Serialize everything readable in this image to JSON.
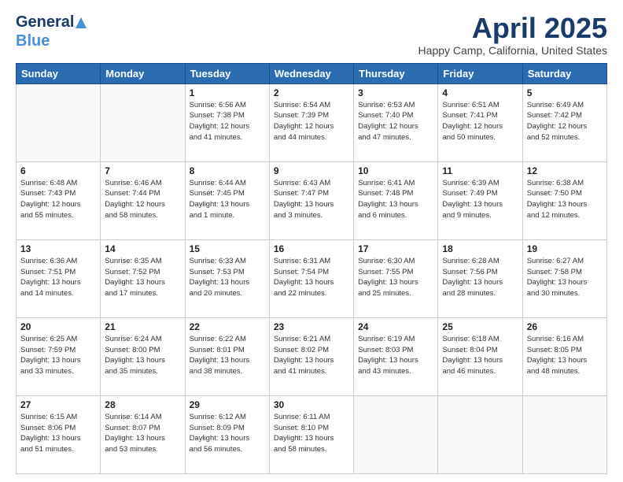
{
  "header": {
    "logo_line1": "General",
    "logo_line2": "Blue",
    "month_title": "April 2025",
    "location": "Happy Camp, California, United States"
  },
  "days_of_week": [
    "Sunday",
    "Monday",
    "Tuesday",
    "Wednesday",
    "Thursday",
    "Friday",
    "Saturday"
  ],
  "weeks": [
    [
      {
        "day": "",
        "info": ""
      },
      {
        "day": "",
        "info": ""
      },
      {
        "day": "1",
        "info": "Sunrise: 6:56 AM\nSunset: 7:38 PM\nDaylight: 12 hours\nand 41 minutes."
      },
      {
        "day": "2",
        "info": "Sunrise: 6:54 AM\nSunset: 7:39 PM\nDaylight: 12 hours\nand 44 minutes."
      },
      {
        "day": "3",
        "info": "Sunrise: 6:53 AM\nSunset: 7:40 PM\nDaylight: 12 hours\nand 47 minutes."
      },
      {
        "day": "4",
        "info": "Sunrise: 6:51 AM\nSunset: 7:41 PM\nDaylight: 12 hours\nand 50 minutes."
      },
      {
        "day": "5",
        "info": "Sunrise: 6:49 AM\nSunset: 7:42 PM\nDaylight: 12 hours\nand 52 minutes."
      }
    ],
    [
      {
        "day": "6",
        "info": "Sunrise: 6:48 AM\nSunset: 7:43 PM\nDaylight: 12 hours\nand 55 minutes."
      },
      {
        "day": "7",
        "info": "Sunrise: 6:46 AM\nSunset: 7:44 PM\nDaylight: 12 hours\nand 58 minutes."
      },
      {
        "day": "8",
        "info": "Sunrise: 6:44 AM\nSunset: 7:45 PM\nDaylight: 13 hours\nand 1 minute."
      },
      {
        "day": "9",
        "info": "Sunrise: 6:43 AM\nSunset: 7:47 PM\nDaylight: 13 hours\nand 3 minutes."
      },
      {
        "day": "10",
        "info": "Sunrise: 6:41 AM\nSunset: 7:48 PM\nDaylight: 13 hours\nand 6 minutes."
      },
      {
        "day": "11",
        "info": "Sunrise: 6:39 AM\nSunset: 7:49 PM\nDaylight: 13 hours\nand 9 minutes."
      },
      {
        "day": "12",
        "info": "Sunrise: 6:38 AM\nSunset: 7:50 PM\nDaylight: 13 hours\nand 12 minutes."
      }
    ],
    [
      {
        "day": "13",
        "info": "Sunrise: 6:36 AM\nSunset: 7:51 PM\nDaylight: 13 hours\nand 14 minutes."
      },
      {
        "day": "14",
        "info": "Sunrise: 6:35 AM\nSunset: 7:52 PM\nDaylight: 13 hours\nand 17 minutes."
      },
      {
        "day": "15",
        "info": "Sunrise: 6:33 AM\nSunset: 7:53 PM\nDaylight: 13 hours\nand 20 minutes."
      },
      {
        "day": "16",
        "info": "Sunrise: 6:31 AM\nSunset: 7:54 PM\nDaylight: 13 hours\nand 22 minutes."
      },
      {
        "day": "17",
        "info": "Sunrise: 6:30 AM\nSunset: 7:55 PM\nDaylight: 13 hours\nand 25 minutes."
      },
      {
        "day": "18",
        "info": "Sunrise: 6:28 AM\nSunset: 7:56 PM\nDaylight: 13 hours\nand 28 minutes."
      },
      {
        "day": "19",
        "info": "Sunrise: 6:27 AM\nSunset: 7:58 PM\nDaylight: 13 hours\nand 30 minutes."
      }
    ],
    [
      {
        "day": "20",
        "info": "Sunrise: 6:25 AM\nSunset: 7:59 PM\nDaylight: 13 hours\nand 33 minutes."
      },
      {
        "day": "21",
        "info": "Sunrise: 6:24 AM\nSunset: 8:00 PM\nDaylight: 13 hours\nand 35 minutes."
      },
      {
        "day": "22",
        "info": "Sunrise: 6:22 AM\nSunset: 8:01 PM\nDaylight: 13 hours\nand 38 minutes."
      },
      {
        "day": "23",
        "info": "Sunrise: 6:21 AM\nSunset: 8:02 PM\nDaylight: 13 hours\nand 41 minutes."
      },
      {
        "day": "24",
        "info": "Sunrise: 6:19 AM\nSunset: 8:03 PM\nDaylight: 13 hours\nand 43 minutes."
      },
      {
        "day": "25",
        "info": "Sunrise: 6:18 AM\nSunset: 8:04 PM\nDaylight: 13 hours\nand 46 minutes."
      },
      {
        "day": "26",
        "info": "Sunrise: 6:16 AM\nSunset: 8:05 PM\nDaylight: 13 hours\nand 48 minutes."
      }
    ],
    [
      {
        "day": "27",
        "info": "Sunrise: 6:15 AM\nSunset: 8:06 PM\nDaylight: 13 hours\nand 51 minutes."
      },
      {
        "day": "28",
        "info": "Sunrise: 6:14 AM\nSunset: 8:07 PM\nDaylight: 13 hours\nand 53 minutes."
      },
      {
        "day": "29",
        "info": "Sunrise: 6:12 AM\nSunset: 8:09 PM\nDaylight: 13 hours\nand 56 minutes."
      },
      {
        "day": "30",
        "info": "Sunrise: 6:11 AM\nSunset: 8:10 PM\nDaylight: 13 hours\nand 58 minutes."
      },
      {
        "day": "",
        "info": ""
      },
      {
        "day": "",
        "info": ""
      },
      {
        "day": "",
        "info": ""
      }
    ]
  ]
}
